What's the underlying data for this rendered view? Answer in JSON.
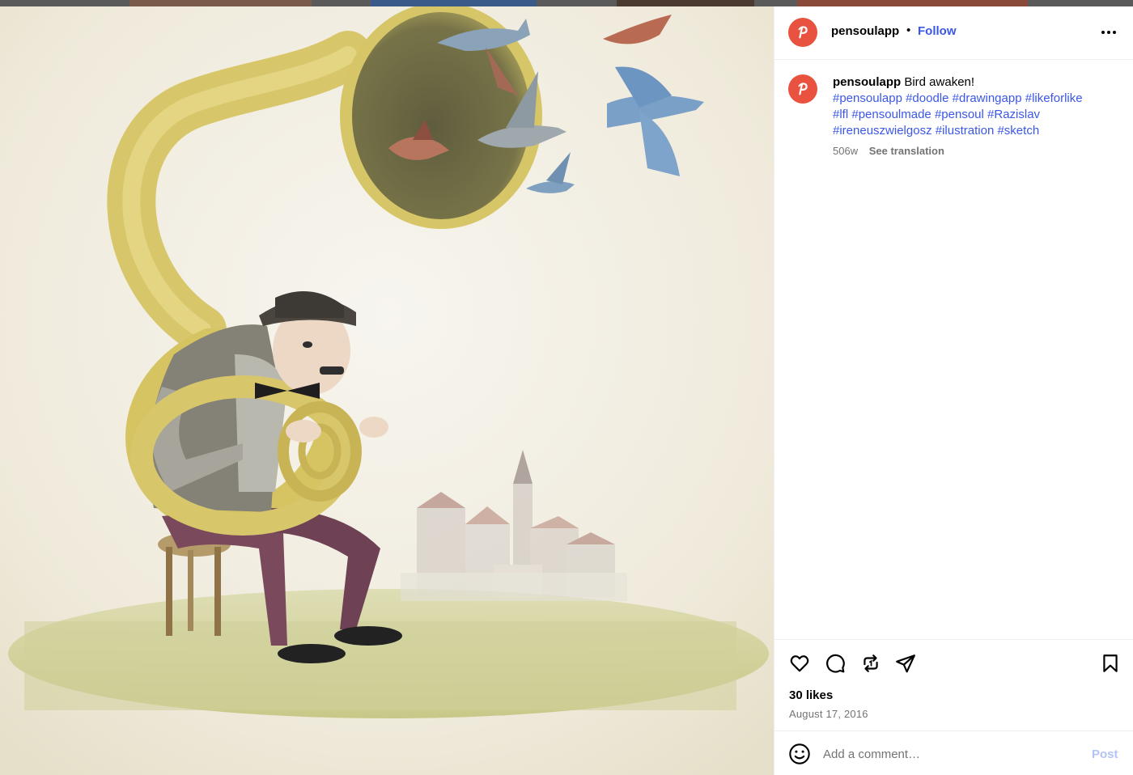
{
  "post": {
    "username": "pensoulapp",
    "separator": "•",
    "follow_label": "Follow",
    "more_icon": "more-horizontal-icon",
    "caption": {
      "username": "pensoulapp",
      "text": "Bird awaken!",
      "hashtags": [
        "#pensoulapp",
        "#doodle",
        "#drawingapp",
        "#likeforlike",
        "#lfl",
        "#pensoulmade",
        "#pensoul",
        "#Razislav",
        "#ireneuszwielgosz",
        "#ilustration",
        "#sketch"
      ],
      "age": "506w",
      "see_translation": "See translation"
    },
    "actions": {
      "like_icon": "heart-icon",
      "comment_icon": "comment-icon",
      "repost_icon": "repost-icon",
      "share_icon": "share-icon",
      "save_icon": "bookmark-icon"
    },
    "likes": "30 likes",
    "date": "August 17, 2016",
    "comment": {
      "placeholder": "Add a comment…",
      "post_label": "Post",
      "emoji_icon": "emoji-icon"
    }
  },
  "colors": {
    "accent": "#3b57e8",
    "avatar": "#e8523f",
    "muted": "#737373",
    "post_disabled": "#b2c4f5"
  }
}
